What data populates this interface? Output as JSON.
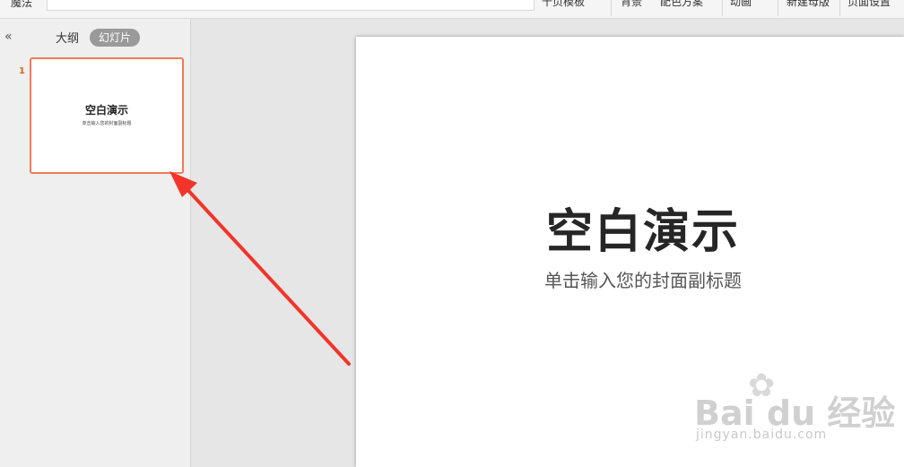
{
  "toolbar": {
    "left_label": "魔法",
    "items": [
      "十页模板",
      "背景",
      "配色方案",
      "动画",
      "新建母版",
      "页面设置"
    ]
  },
  "panel": {
    "collapse_icon": "double-chevron-left-icon",
    "tab_outline": "大纲",
    "tab_slides": "幻灯片",
    "slides": [
      {
        "number": "1",
        "title": "空白演示",
        "subtitle": "单击输入您的封面副标题"
      }
    ]
  },
  "slide": {
    "title": "空白演示",
    "subtitle": "单击输入您的封面副标题"
  },
  "watermark": {
    "logo": "Bai du 经验",
    "url": "jingyan.baidu.com"
  },
  "colors": {
    "thumb_border": "#f27a57",
    "arrow": "#f2342a",
    "slide_number": "#d2691e"
  }
}
